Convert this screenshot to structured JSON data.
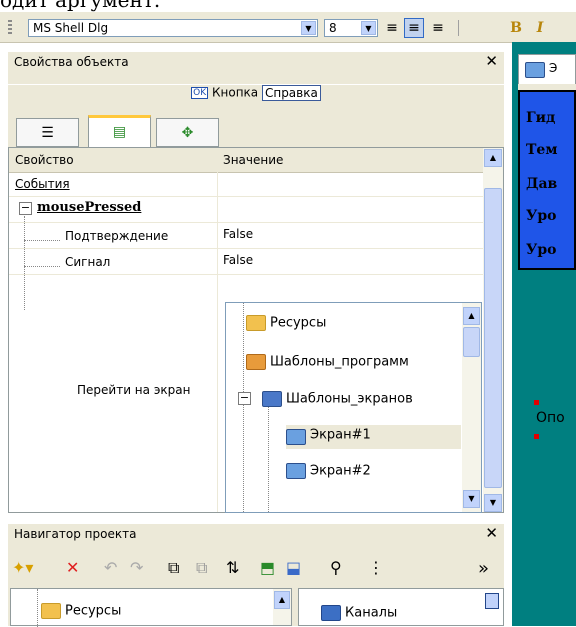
{
  "top_fragment": "одит аргумент.",
  "toolbar": {
    "font_name": "MS Shell Dlg",
    "font_size": "8",
    "bold_label": "B",
    "italic_label": "I"
  },
  "props_panel": {
    "title": "Свойства объекта",
    "close_glyph": "✕",
    "object_icon_text": "OK",
    "object_name": "Кнопка",
    "object_value": "Справка",
    "headers": {
      "property": "Свойство",
      "value": "Значение"
    },
    "rows": [
      {
        "name": "События",
        "value": ""
      },
      {
        "name": "mousePressed",
        "value": ""
      },
      {
        "name": "Подтверждение",
        "value": "False"
      },
      {
        "name": "Сигнал",
        "value": "False"
      },
      {
        "name": "Перейти на экран",
        "value": ""
      }
    ],
    "tree": [
      {
        "label": "Ресурсы",
        "icon": "folder-icon"
      },
      {
        "label": "Шаблоны_программ",
        "icon": "program-template-icon"
      },
      {
        "label": "Шаблоны_экранов",
        "icon": "screen-templates-icon",
        "expanded": true
      },
      {
        "label": "Экран#1",
        "icon": "screen-icon",
        "selected": true
      },
      {
        "label": "Экран#2",
        "icon": "screen-icon"
      }
    ]
  },
  "nav_panel": {
    "title": "Навигатор проекта",
    "close_glyph": "✕",
    "more_glyph": "»",
    "items": [
      {
        "label": "Ресурсы"
      }
    ],
    "right_items": [
      {
        "label": "Каналы"
      }
    ]
  },
  "right_area": {
    "tab_label": "Э",
    "lines": [
      "Гид",
      "Тем",
      "Дав",
      "Уро",
      "Уро"
    ],
    "caption": "Опо"
  },
  "colors": {
    "chrome": "#ece9d8",
    "accent": "#316ac5",
    "screen_bg": "#007f80",
    "blue_box": "#1f55e8"
  }
}
